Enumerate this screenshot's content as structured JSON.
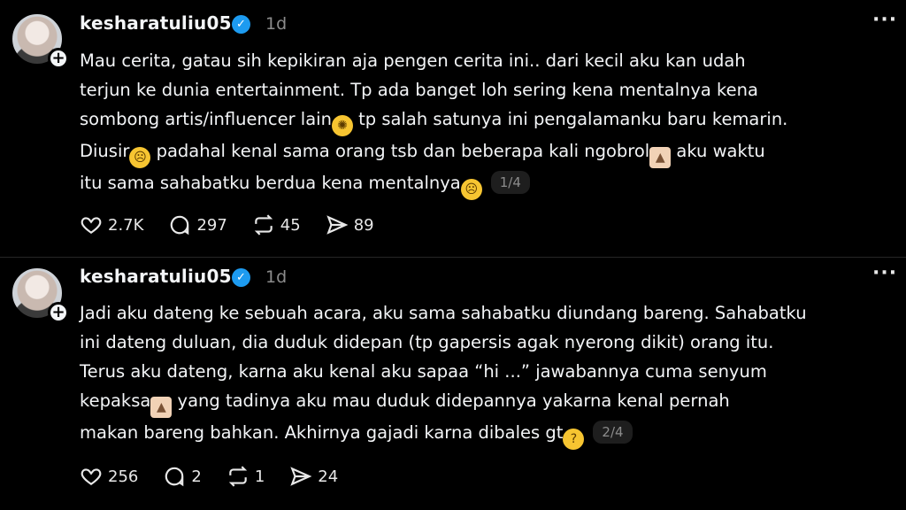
{
  "posts": [
    {
      "username": "kesharatuliu05",
      "time": "1d",
      "lines": [
        "Mau cerita, gatau sih kepikiran aja pengen cerita ini.. dari kecil aku kan udah",
        "terjun ke dunia entertainment. Tp ada banget loh sering kena mentalnya kena",
        [
          "sombong artis/influencer lain",
          " tp salah satunya ini pengalamanku baru kemarin."
        ],
        [
          "Diusir",
          " padahal kenal sama orang tsb dan beberapa kali ngobrol",
          " aku waktu"
        ],
        [
          "itu sama sahabatku berdua kena mentalnya"
        ]
      ],
      "counter": "1/4",
      "likes": "2.7K",
      "comments": "297",
      "reposts": "45",
      "shares": "89"
    },
    {
      "username": "kesharatuliu05",
      "time": "1d",
      "lines": [
        "Jadi aku dateng ke sebuah acara, aku sama sahabatku diundang bareng. Sahabatku",
        "ini dateng duluan, dia duduk didepan (tp gapersis agak nyerong dikit) orang itu.",
        "Terus aku dateng, karna aku kenal aku sapaa “hi ...” jawabannya cuma senyum",
        [
          "kepaksa",
          " yang tadinya aku mau duduk didepannya yakarna kenal pernah"
        ],
        [
          "makan bareng bahkan. Akhirnya gajadi karna dibales gt"
        ]
      ],
      "counter": "2/4",
      "likes": "256",
      "comments": "2",
      "reposts": "1",
      "shares": "24"
    }
  ],
  "icons": {
    "verified": "verified-badge-icon",
    "more": "more-options-icon",
    "like": "heart-icon",
    "comment": "comment-icon",
    "repost": "repost-icon",
    "share": "share-icon",
    "emoji_mindblown": "exploding-head-emoji",
    "emoji_sweat": "downcast-sweat-emoji",
    "emoji_pray": "folded-hands-emoji",
    "emoji_think": "thinking-face-emoji"
  },
  "colors": {
    "background": "#000000",
    "text": "#f3f5f7",
    "muted": "#8c8c8c",
    "verified": "#1d9bf0"
  }
}
